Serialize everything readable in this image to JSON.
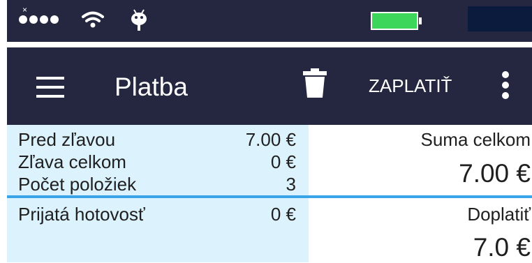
{
  "status_bar": {
    "corner_mark": "×",
    "icons": [
      "signal-dots-icon",
      "wifi-icon",
      "android-icon",
      "battery-icon"
    ],
    "battery_fill_fraction": 0.9,
    "colors": {
      "bar": "#24273f",
      "battery": "#3bd65a"
    }
  },
  "app_bar": {
    "title": "Platba",
    "menu_icon": "menu-icon",
    "delete_icon": "trash-icon",
    "pay_label": "ZAPLATIŤ",
    "more_icon": "more-vert-icon"
  },
  "summary": {
    "before_discount": {
      "label": "Pred zľavou",
      "value": "7.00 €"
    },
    "discount_total": {
      "label": "Zľava celkom",
      "value": "0 €"
    },
    "item_count": {
      "label": "Počet položiek",
      "value": "3"
    },
    "cash_received": {
      "label": "Prijatá hotovosť",
      "value": "0 €"
    }
  },
  "totals": {
    "total_label": "Suma celkom",
    "total_value": "7.00 €",
    "remaining_label": "Doplatiť",
    "remaining_value": "7.0 €"
  },
  "colors": {
    "left_panel": "#dcf3fe",
    "divider": "#3aa4e8",
    "text": "#1f1f1f"
  }
}
